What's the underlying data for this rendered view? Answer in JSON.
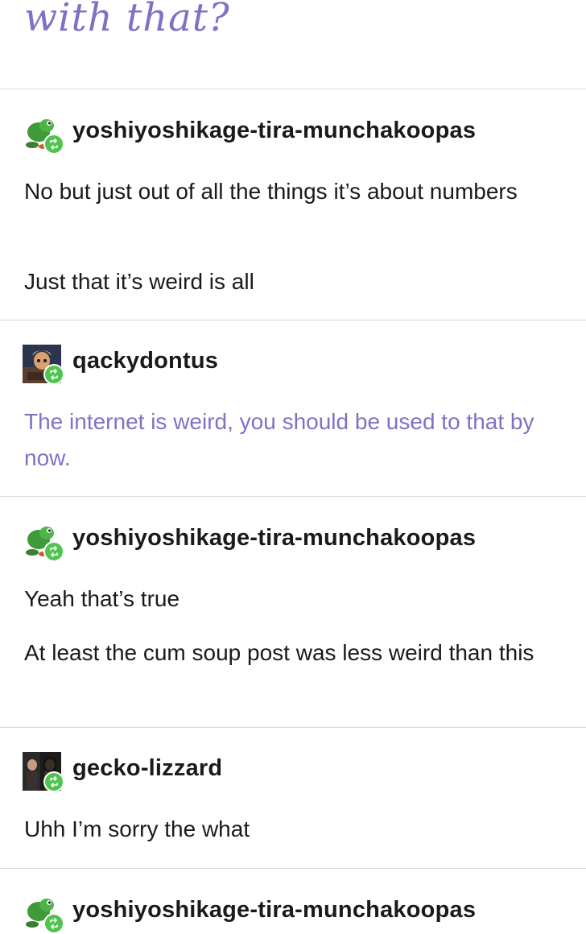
{
  "header": {
    "title_fragment": "with that?"
  },
  "colors": {
    "accent_purple": "#7e72c4",
    "reblog_green": "#4fc550",
    "divider": "#d9d9d9"
  },
  "posts": [
    {
      "username": "yoshiyoshikage-tira-munchakoopas",
      "avatar_icon": "yoshi-avatar-icon",
      "paragraphs": [
        "No but just out of all the things it’s about numbers",
        "Just that it’s weird is all"
      ]
    },
    {
      "username": "qackydontus",
      "avatar_icon": "character-avatar-icon",
      "paragraphs": [
        "The internet is weird, you should be used to that by now."
      ]
    },
    {
      "username": "yoshiyoshikage-tira-munchakoopas",
      "avatar_icon": "yoshi-avatar-icon",
      "paragraphs": [
        "Yeah that’s true",
        "At least the cum soup post was less weird than this"
      ]
    },
    {
      "username": "gecko-lizzard",
      "avatar_icon": "photo-avatar-icon",
      "paragraphs": [
        "Uhh I’m sorry the what"
      ]
    },
    {
      "username": "yoshiyoshikage-tira-munchakoopas",
      "avatar_icon": "yoshi-avatar-icon",
      "paragraphs": []
    }
  ]
}
